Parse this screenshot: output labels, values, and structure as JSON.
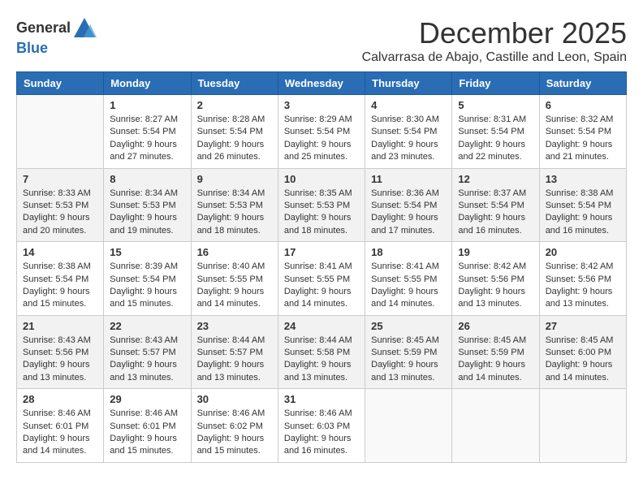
{
  "logo": {
    "general": "General",
    "blue": "Blue"
  },
  "header": {
    "month_title": "December 2025",
    "subtitle": "Calvarrasa de Abajo, Castille and Leon, Spain"
  },
  "weekdays": [
    "Sunday",
    "Monday",
    "Tuesday",
    "Wednesday",
    "Thursday",
    "Friday",
    "Saturday"
  ],
  "weeks": [
    [
      {
        "day": "",
        "info": ""
      },
      {
        "day": "1",
        "info": "Sunrise: 8:27 AM\nSunset: 5:54 PM\nDaylight: 9 hours\nand 27 minutes."
      },
      {
        "day": "2",
        "info": "Sunrise: 8:28 AM\nSunset: 5:54 PM\nDaylight: 9 hours\nand 26 minutes."
      },
      {
        "day": "3",
        "info": "Sunrise: 8:29 AM\nSunset: 5:54 PM\nDaylight: 9 hours\nand 25 minutes."
      },
      {
        "day": "4",
        "info": "Sunrise: 8:30 AM\nSunset: 5:54 PM\nDaylight: 9 hours\nand 23 minutes."
      },
      {
        "day": "5",
        "info": "Sunrise: 8:31 AM\nSunset: 5:54 PM\nDaylight: 9 hours\nand 22 minutes."
      },
      {
        "day": "6",
        "info": "Sunrise: 8:32 AM\nSunset: 5:54 PM\nDaylight: 9 hours\nand 21 minutes."
      }
    ],
    [
      {
        "day": "7",
        "info": "Sunrise: 8:33 AM\nSunset: 5:53 PM\nDaylight: 9 hours\nand 20 minutes."
      },
      {
        "day": "8",
        "info": "Sunrise: 8:34 AM\nSunset: 5:53 PM\nDaylight: 9 hours\nand 19 minutes."
      },
      {
        "day": "9",
        "info": "Sunrise: 8:34 AM\nSunset: 5:53 PM\nDaylight: 9 hours\nand 18 minutes."
      },
      {
        "day": "10",
        "info": "Sunrise: 8:35 AM\nSunset: 5:53 PM\nDaylight: 9 hours\nand 18 minutes."
      },
      {
        "day": "11",
        "info": "Sunrise: 8:36 AM\nSunset: 5:54 PM\nDaylight: 9 hours\nand 17 minutes."
      },
      {
        "day": "12",
        "info": "Sunrise: 8:37 AM\nSunset: 5:54 PM\nDaylight: 9 hours\nand 16 minutes."
      },
      {
        "day": "13",
        "info": "Sunrise: 8:38 AM\nSunset: 5:54 PM\nDaylight: 9 hours\nand 16 minutes."
      }
    ],
    [
      {
        "day": "14",
        "info": "Sunrise: 8:38 AM\nSunset: 5:54 PM\nDaylight: 9 hours\nand 15 minutes."
      },
      {
        "day": "15",
        "info": "Sunrise: 8:39 AM\nSunset: 5:54 PM\nDaylight: 9 hours\nand 15 minutes."
      },
      {
        "day": "16",
        "info": "Sunrise: 8:40 AM\nSunset: 5:55 PM\nDaylight: 9 hours\nand 14 minutes."
      },
      {
        "day": "17",
        "info": "Sunrise: 8:41 AM\nSunset: 5:55 PM\nDaylight: 9 hours\nand 14 minutes."
      },
      {
        "day": "18",
        "info": "Sunrise: 8:41 AM\nSunset: 5:55 PM\nDaylight: 9 hours\nand 14 minutes."
      },
      {
        "day": "19",
        "info": "Sunrise: 8:42 AM\nSunset: 5:56 PM\nDaylight: 9 hours\nand 13 minutes."
      },
      {
        "day": "20",
        "info": "Sunrise: 8:42 AM\nSunset: 5:56 PM\nDaylight: 9 hours\nand 13 minutes."
      }
    ],
    [
      {
        "day": "21",
        "info": "Sunrise: 8:43 AM\nSunset: 5:56 PM\nDaylight: 9 hours\nand 13 minutes."
      },
      {
        "day": "22",
        "info": "Sunrise: 8:43 AM\nSunset: 5:57 PM\nDaylight: 9 hours\nand 13 minutes."
      },
      {
        "day": "23",
        "info": "Sunrise: 8:44 AM\nSunset: 5:57 PM\nDaylight: 9 hours\nand 13 minutes."
      },
      {
        "day": "24",
        "info": "Sunrise: 8:44 AM\nSunset: 5:58 PM\nDaylight: 9 hours\nand 13 minutes."
      },
      {
        "day": "25",
        "info": "Sunrise: 8:45 AM\nSunset: 5:59 PM\nDaylight: 9 hours\nand 13 minutes."
      },
      {
        "day": "26",
        "info": "Sunrise: 8:45 AM\nSunset: 5:59 PM\nDaylight: 9 hours\nand 14 minutes."
      },
      {
        "day": "27",
        "info": "Sunrise: 8:45 AM\nSunset: 6:00 PM\nDaylight: 9 hours\nand 14 minutes."
      }
    ],
    [
      {
        "day": "28",
        "info": "Sunrise: 8:46 AM\nSunset: 6:01 PM\nDaylight: 9 hours\nand 14 minutes."
      },
      {
        "day": "29",
        "info": "Sunrise: 8:46 AM\nSunset: 6:01 PM\nDaylight: 9 hours\nand 15 minutes."
      },
      {
        "day": "30",
        "info": "Sunrise: 8:46 AM\nSunset: 6:02 PM\nDaylight: 9 hours\nand 15 minutes."
      },
      {
        "day": "31",
        "info": "Sunrise: 8:46 AM\nSunset: 6:03 PM\nDaylight: 9 hours\nand 16 minutes."
      },
      {
        "day": "",
        "info": ""
      },
      {
        "day": "",
        "info": ""
      },
      {
        "day": "",
        "info": ""
      }
    ]
  ]
}
